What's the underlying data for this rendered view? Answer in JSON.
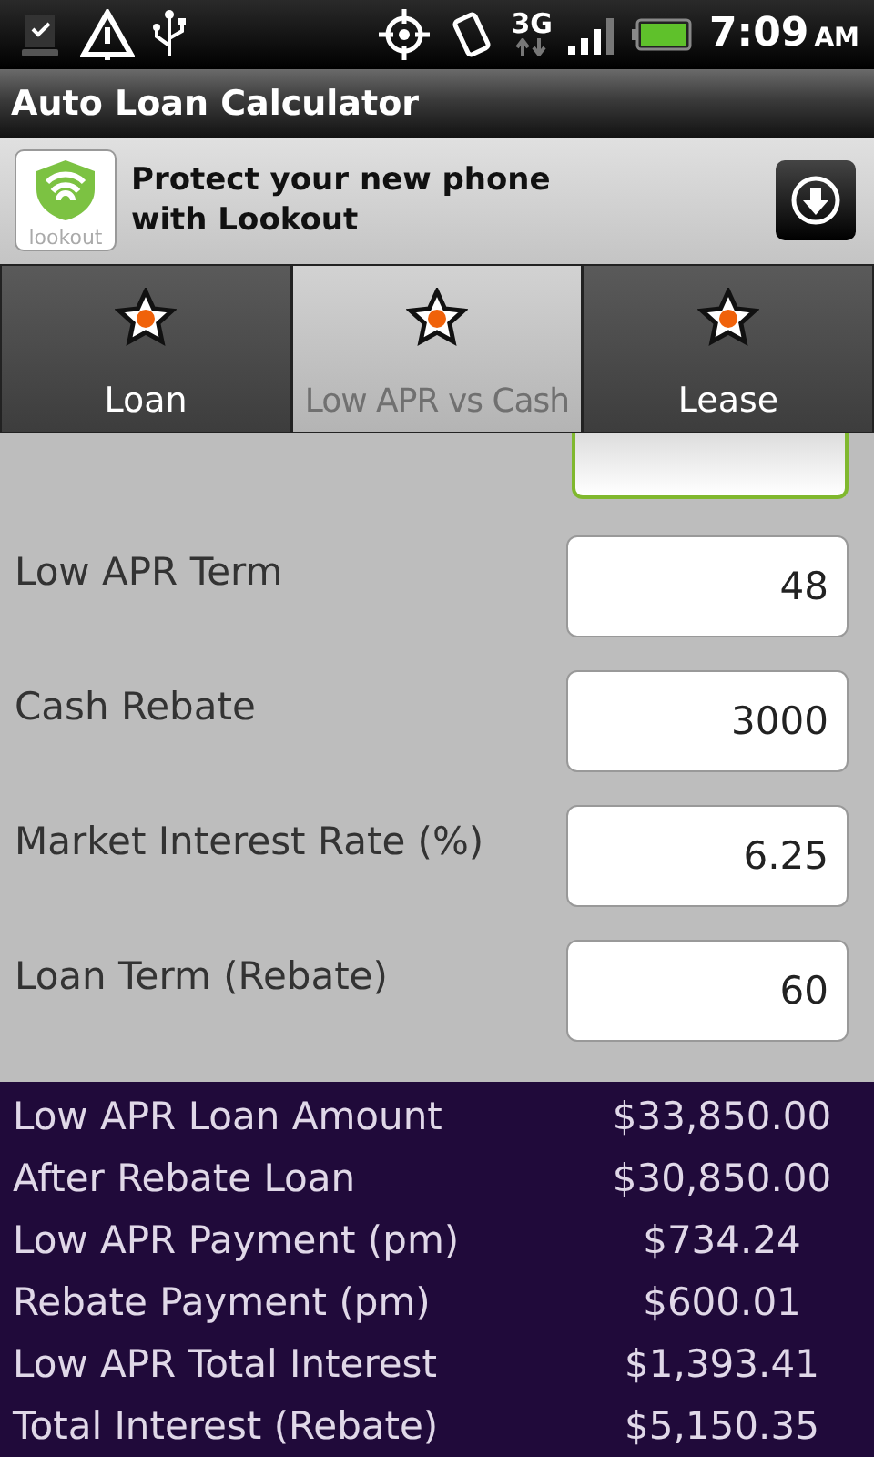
{
  "status_bar": {
    "network": "3G",
    "time": "7:09",
    "meridiem": "AM"
  },
  "window": {
    "title": "Auto Loan Calculator"
  },
  "ad": {
    "text": "Protect your new phone with Lookout",
    "logo_text": "lookout"
  },
  "tabs": [
    {
      "label": "Loan",
      "selected": false
    },
    {
      "label": "Low APR vs Cash",
      "selected": true
    },
    {
      "label": "Lease",
      "selected": false
    }
  ],
  "partial_field": {
    "focused": true
  },
  "inputs": [
    {
      "label": "Low APR Term",
      "value": "48"
    },
    {
      "label": "Cash Rebate",
      "value": "3000"
    },
    {
      "label": "Market Interest Rate (%)",
      "value": "6.25"
    },
    {
      "label": "Loan Term (Rebate)",
      "value": "60"
    }
  ],
  "results": [
    {
      "label": "Low APR Loan Amount",
      "value": "$33,850.00"
    },
    {
      "label": "After Rebate Loan",
      "value": "$30,850.00"
    },
    {
      "label": "Low APR Payment (pm)",
      "value": "$734.24"
    },
    {
      "label": "Rebate Payment (pm)",
      "value": "$600.01"
    },
    {
      "label": "Low APR Total Interest",
      "value": "$1,393.41"
    },
    {
      "label": "Total Interest (Rebate)",
      "value": "$5,150.35"
    }
  ]
}
